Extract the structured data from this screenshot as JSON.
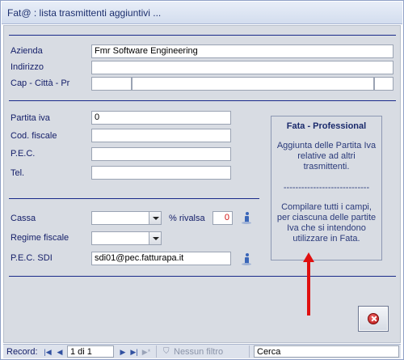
{
  "window": {
    "title": "Fat@ : lista trasmittenti aggiuntivi ..."
  },
  "company": {
    "azienda_label": "Azienda",
    "azienda_value": "Fmr Software Engineering",
    "indirizzo_label": "Indirizzo",
    "indirizzo_value": "",
    "cap_label": "Cap - Città - Pr",
    "cap_value": "",
    "citta_value": "",
    "pr_value": ""
  },
  "fiscal": {
    "partita_iva_label": "Partita iva",
    "partita_iva_value": "0",
    "cod_fiscale_label": "Cod. fiscale",
    "cod_fiscale_value": "",
    "pec_label": "P.E.C.",
    "pec_value": "",
    "tel_label": "Tel.",
    "tel_value": ""
  },
  "extra": {
    "cassa_label": "Cassa",
    "cassa_value": "",
    "rivalsa_label": "% rivalsa",
    "rivalsa_value": "0",
    "regime_label": "Regime fiscale",
    "regime_value": "",
    "pec_sdi_label": "P.E.C. SDI",
    "pec_sdi_value": "sdi01@pec.fatturapa.it"
  },
  "panel": {
    "title": "Fata - Professional",
    "text1_line1": "Aggiunta delle Partita Iva",
    "text1_line2": "relative ad altri",
    "text1_line3": "trasmittenti.",
    "separator": "-----------------------------",
    "text2_line1": "Compilare tutti i campi,",
    "text2_line2": "per ciascuna delle partite",
    "text2_line3": "Iva che si intendono",
    "text2_line4": "utilizzare in Fata."
  },
  "navigation": {
    "record_label": "Record:",
    "position": "1 di 1",
    "filter_label": "Nessun filtro",
    "search_placeholder": "Cerca"
  },
  "colors": {
    "accent_red": "#e01010",
    "label_blue": "#16206a",
    "form_bg": "#d8dce3"
  },
  "icons": {
    "info": "info-icon",
    "close": "close-icon",
    "arrow": "red-arrow-up"
  }
}
